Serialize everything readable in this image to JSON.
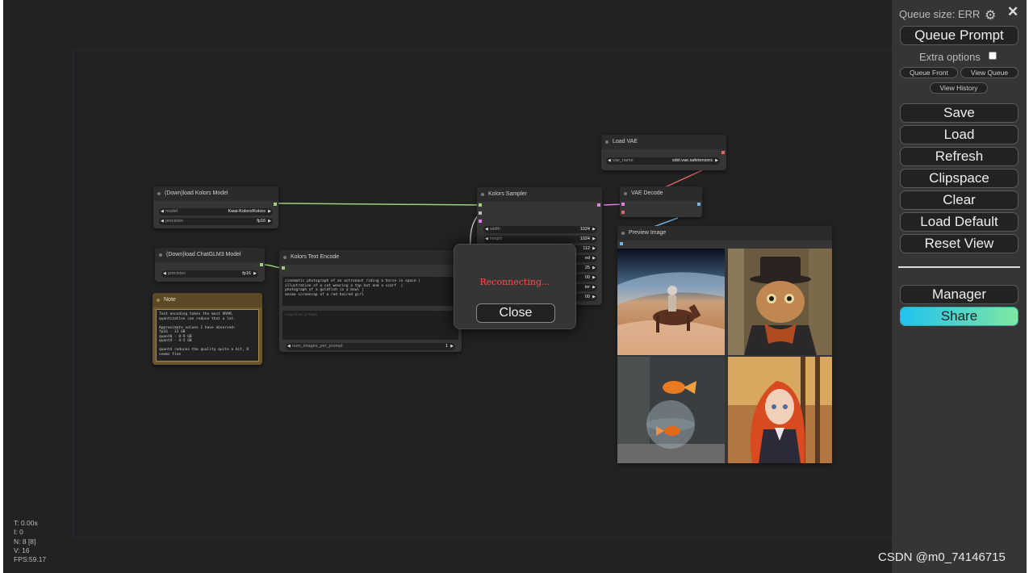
{
  "menu": {
    "queue_size": "Queue size: ERR",
    "queue_prompt": "Queue Prompt",
    "extra_options": "Extra options",
    "queue_front": "Queue Front",
    "view_queue": "View Queue",
    "view_history": "View History",
    "save": "Save",
    "load": "Load",
    "refresh": "Refresh",
    "clipspace": "Clipspace",
    "clear": "Clear",
    "load_default": "Load Default",
    "reset_view": "Reset View",
    "manager": "Manager",
    "share": "Share"
  },
  "nodes": {
    "load_vae": {
      "title": "Load VAE",
      "vae_name_label": "vae_name",
      "vae_name": "sdxl.vae.safetensors"
    },
    "kolors_model": {
      "title": "(Down)load Kolors Model",
      "model_label": "model",
      "model": "Kwai-Kolors/Kolors",
      "precision_label": "precision",
      "precision": "fp16"
    },
    "chatglm_model": {
      "title": "(Down)load ChatGLM3 Model",
      "precision_label": "precision",
      "precision": "fp16"
    },
    "note": {
      "title": "Note",
      "text": "Text encoding takes the most VRAM,\nquantization can reduce that a lot.\n\nApproximate values I have observed:\nfp16 - 13 GB\nquant8 - 8-9 GB\nquant4 - 4-5 GB\n\nquant4 reduces the quality quite a bit, 8\nseems fine"
    },
    "text_encode": {
      "title": "Kolors Text Encode",
      "prompt": "cinematic photograph of an astronaut riding a horse in space |\nillustration of a cat wearing a top hat and a scarf  |\nphotograph of a goldfish in a bowl |\nanime screencap of a red haired girl",
      "negative_placeholder": "negative_prompt",
      "num_images_label": "num_images_per_prompt",
      "num_images": "1"
    },
    "sampler": {
      "title": "Kolors Sampler",
      "width_label": "width",
      "width": "1024",
      "height_label": "height",
      "height": "1024",
      "row3_value": "112",
      "row4_label": "ed",
      "row5_value": "25",
      "row6_value": "00",
      "row7_label": "ler",
      "row8_value": "00"
    },
    "vae_decode": {
      "title": "VAE Decode"
    },
    "preview": {
      "title": "Preview Image"
    }
  },
  "dialog": {
    "message": "Reconnecting...",
    "close": "Close"
  },
  "stats": {
    "t": "T: 0.00s",
    "i": "I: 0",
    "n": "N: 8 [8]",
    "v": "V: 16",
    "fps": "FPS:59.17"
  },
  "watermark": "CSDN @m0_74146715",
  "colors": {
    "canvas": "#222222",
    "menu": "#353535",
    "error_text": "#ff4d4d",
    "share_gradient_start": "#21c2f0",
    "share_gradient_end": "#7ee8a0"
  },
  "icons": [
    "gear-icon",
    "close-icon"
  ]
}
